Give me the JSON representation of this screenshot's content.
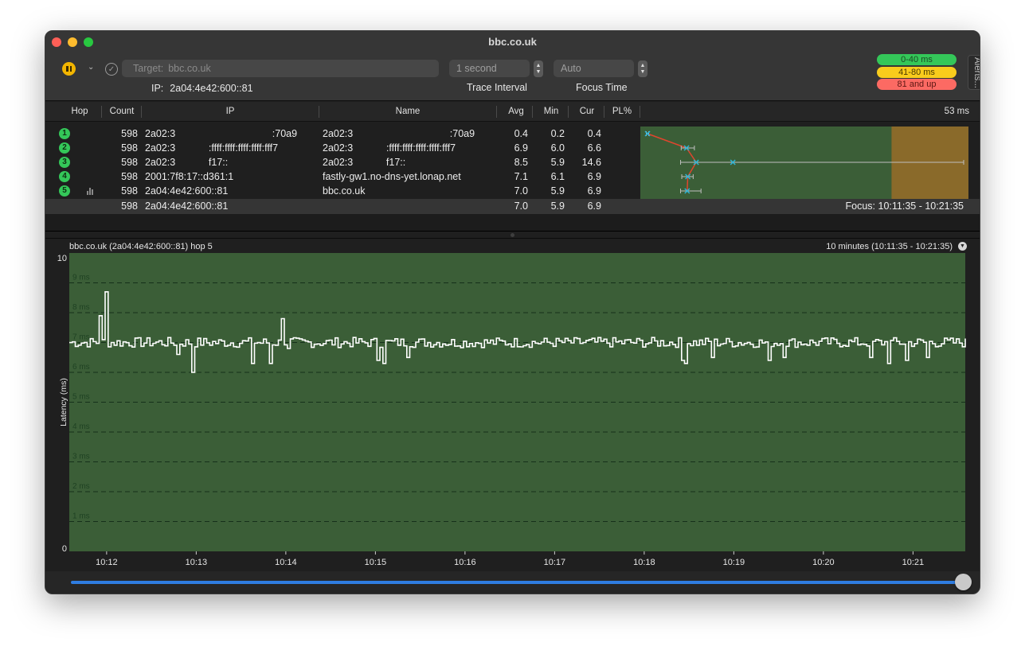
{
  "window": {
    "title": "bbc.co.uk"
  },
  "toolbar": {
    "target_label": "Target:",
    "target_value": "bbc.co.uk",
    "ip_label": "IP:",
    "ip_value": "2a04:4e42:600::81",
    "trace_interval_value": "1 second",
    "trace_interval_label": "Trace Interval",
    "focus_time_value": "Auto",
    "focus_time_label": "Focus Time",
    "alerts_label": "Alerts..."
  },
  "latency_legend": [
    {
      "label": "0-40 ms",
      "color": "#34c759"
    },
    {
      "label": "41-80 ms",
      "color": "#f9cc1c"
    },
    {
      "label": "81 and up",
      "color": "#fc6a63"
    }
  ],
  "columns": {
    "hop": "Hop",
    "count": "Count",
    "ip": "IP",
    "name": "Name",
    "avg": "Avg",
    "min": "Min",
    "cur": "Cur",
    "pl": "PL%",
    "max_ms": "53 ms"
  },
  "hops": [
    {
      "hop": "1",
      "count": "598",
      "ip": "2a02:3                                   :70a9",
      "name": "2a02:3                                   :70a9",
      "avg": "0.4",
      "min": "0.2",
      "cur": "0.4"
    },
    {
      "hop": "2",
      "count": "598",
      "ip": "2a02:3            :ffff:ffff:ffff:ffff:fff7",
      "name": "2a02:3            :ffff:ffff:ffff:ffff:fff7",
      "avg": "6.9",
      "min": "6.0",
      "cur": "6.6"
    },
    {
      "hop": "3",
      "count": "598",
      "ip": "2a02:3            f17::",
      "name": "2a02:3            f17::",
      "avg": "8.5",
      "min": "5.9",
      "cur": "14.6"
    },
    {
      "hop": "4",
      "count": "598",
      "ip": "2001:7f8:17::d361:1",
      "name": "fastly-gw1.no-dns-yet.lonap.net",
      "avg": "7.1",
      "min": "6.1",
      "cur": "6.9"
    },
    {
      "hop": "5",
      "count": "598",
      "ip": "2a04:4e42:600::81",
      "name": "bbc.co.uk",
      "avg": "7.0",
      "min": "5.9",
      "cur": "6.9"
    }
  ],
  "hop_plot": {
    "max_ms": 53,
    "yellow_from_ms": 41,
    "points": [
      {
        "avg": 0.4,
        "min": 0.2,
        "max": 0.6
      },
      {
        "avg": 6.9,
        "min": 6.0,
        "max": 8.2
      },
      {
        "avg": 8.5,
        "min": 5.9,
        "max": 53,
        "cur": 14.6
      },
      {
        "avg": 7.1,
        "min": 6.1,
        "max": 8.0
      },
      {
        "avg": 7.0,
        "min": 5.9,
        "max": 9.3
      }
    ]
  },
  "summary": {
    "count": "598",
    "ip": "2a04:4e42:600::81",
    "avg": "7.0",
    "min": "5.9",
    "cur": "6.9",
    "focus": "Focus: 10:11:35 - 10:21:35"
  },
  "graph": {
    "title": "bbc.co.uk (2a04:4e42:600::81) hop 5",
    "range": "10 minutes (10:11:35 - 10:21:35)"
  },
  "chart_data": {
    "type": "line",
    "title": "bbc.co.uk (2a04:4e42:600::81) hop 5",
    "ylabel": "Latency (ms)",
    "ylim": [
      0,
      10
    ],
    "y_axis_labels": [
      "10",
      "0"
    ],
    "y_grid_labels": [
      "9 ms",
      "8 ms",
      "7 ms",
      "6 ms",
      "5 ms",
      "4 ms",
      "3 ms",
      "2 ms",
      "1 ms"
    ],
    "x_tick_labels": [
      "10:12",
      "10:13",
      "10:14",
      "10:15",
      "10:16",
      "10:17",
      "10:18",
      "10:19",
      "10:20",
      "10:21"
    ],
    "x_range": [
      "10:11:35",
      "10:21:35"
    ],
    "background": "#3b5e37",
    "series": [
      {
        "color": "#ffffff",
        "baseline_ms": 7.0,
        "spikes": [
          {
            "t": "10:11:55",
            "ms": 7.9
          },
          {
            "t": "10:11:59",
            "ms": 8.7
          },
          {
            "t": "10:12:48",
            "ms": 6.6
          },
          {
            "t": "10:12:58",
            "ms": 6.0
          },
          {
            "t": "10:13:38",
            "ms": 6.3
          },
          {
            "t": "10:13:49",
            "ms": 6.3
          },
          {
            "t": "10:13:57",
            "ms": 7.8
          },
          {
            "t": "10:14:02",
            "ms": 6.8
          },
          {
            "t": "10:15:02",
            "ms": 6.4
          },
          {
            "t": "10:15:05",
            "ms": 6.3
          },
          {
            "t": "10:15:22",
            "ms": 6.5
          },
          {
            "t": "10:18:25",
            "ms": 6.4
          },
          {
            "t": "10:18:27",
            "ms": 6.3
          },
          {
            "t": "10:18:45",
            "ms": 6.5
          },
          {
            "t": "10:19:24",
            "ms": 6.4
          },
          {
            "t": "10:19:33",
            "ms": 6.5
          },
          {
            "t": "10:20:31",
            "ms": 6.5
          },
          {
            "t": "10:20:44",
            "ms": 6.3
          },
          {
            "t": "10:20:55",
            "ms": 6.4
          },
          {
            "t": "10:21:09",
            "ms": 6.5
          }
        ]
      }
    ]
  }
}
